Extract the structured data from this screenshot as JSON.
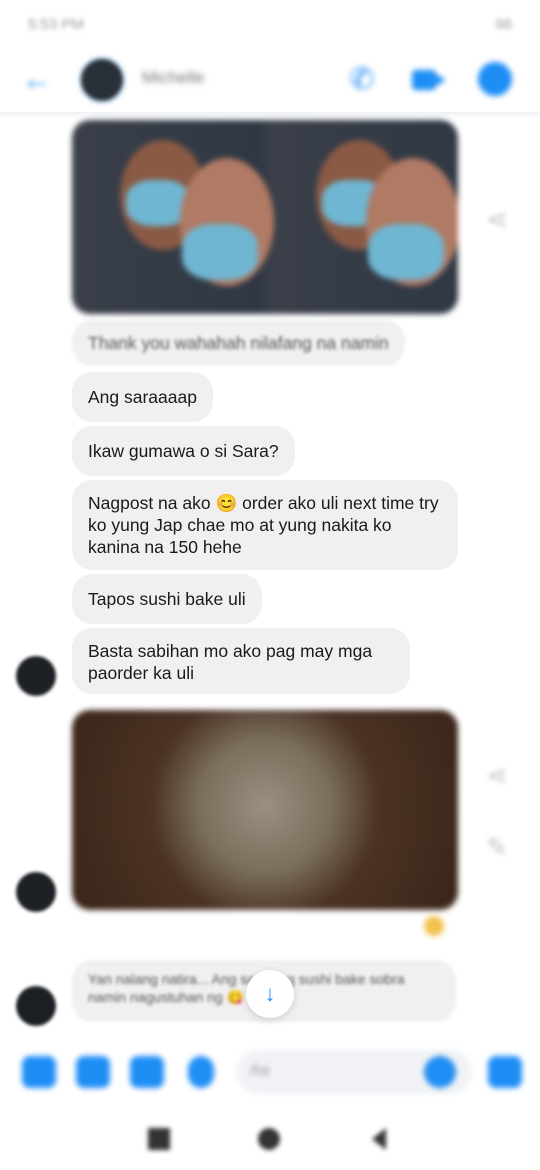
{
  "status": {
    "time": "5:53 PM",
    "speed": "0.4KB/s",
    "battery": "96"
  },
  "header": {
    "back_icon": "back-arrow-icon",
    "contact_name": "Michelle",
    "call_icon": "phone-icon",
    "video_icon": "video-camera-icon",
    "info_icon": "info-icon"
  },
  "messages": [
    {
      "text": "Thank you wahahah nilafang na namin"
    },
    {
      "text": "Ang saraaaap"
    },
    {
      "text": "Ikaw gumawa o si Sara?"
    },
    {
      "text": "Nagpost na ako 😊 order ako uli next time try ko yung Jap chae mo at yung nakita ko kanina na 150 hehe"
    },
    {
      "text": "Tapos sushi bake uli"
    },
    {
      "text": "Basta sabihan mo ako pag may mga paorder ka uli"
    }
  ],
  "last_message": "Yan nalang natira... Ang sarap ng sushi bake sobra namin nagustuhan ng 😋",
  "composer": {
    "placeholder": "Aa"
  },
  "colors": {
    "accent": "#1e8ef5",
    "bubble": "#f0f0f0"
  }
}
